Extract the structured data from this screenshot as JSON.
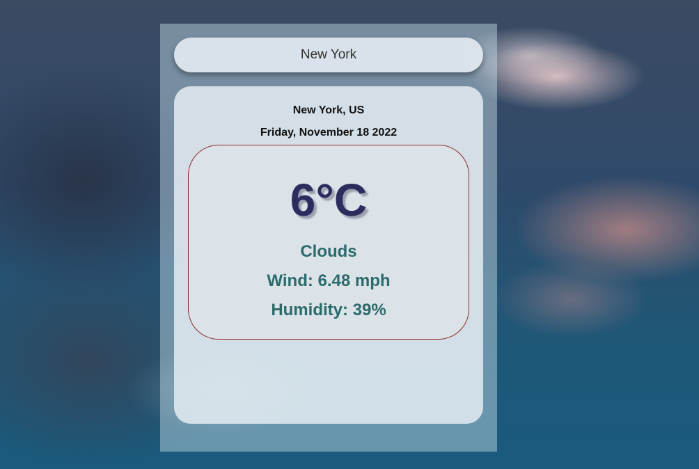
{
  "search": {
    "value": "New York",
    "placeholder": ""
  },
  "weather": {
    "location": "New York, US",
    "date": "Friday, November 18 2022",
    "temperature": "6°C",
    "condition": "Clouds",
    "wind": "Wind: 6.48 mph",
    "humidity": "Humidity: 39%"
  },
  "colors": {
    "temperature_text": "#2e2c5e",
    "details_text": "#2b6b6b",
    "card_border": "#8a2a2a"
  }
}
